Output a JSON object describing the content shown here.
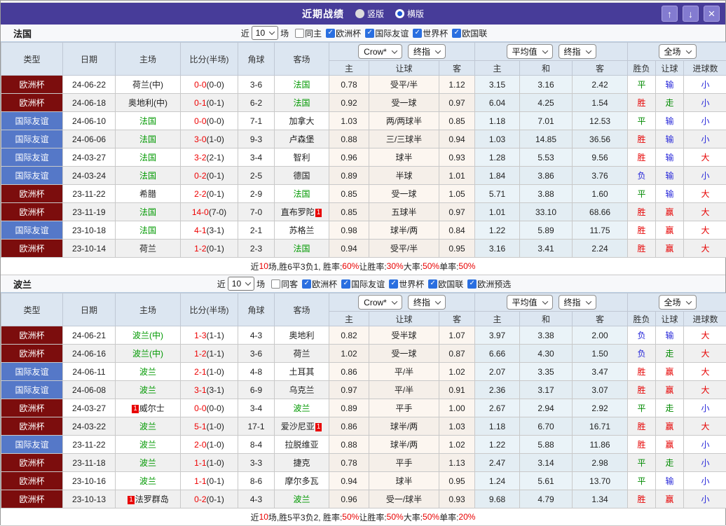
{
  "title_bar": {
    "title": "近期战绩",
    "radio_vertical": "竖版",
    "radio_horizontal": "横版",
    "up_icon": "↑",
    "down_icon": "↓",
    "close_icon": "×"
  },
  "colors": {
    "type": {
      "欧洲杯": "#7c0d0d",
      "国际友谊": "#5578c8"
    },
    "result": {
      "胜": "#e60000",
      "平": "#008a00",
      "负": "#2626d9",
      "赢": "#e60000",
      "走": "#008a00",
      "输": "#2626d9",
      "大": "#e60000",
      "小": "#2626d9"
    },
    "accent_purple": "#473c99",
    "header_bg": "#dce6f1",
    "checkbox_blue": "#2a6fe0"
  },
  "table_header": {
    "type": "类型",
    "date": "日期",
    "home": "主场",
    "score": "比分(半场)",
    "corner": "角球",
    "away": "客场",
    "odds_home": "主",
    "odds_line": "让球",
    "odds_away": "客",
    "avg_home": "主",
    "avg_draw": "和",
    "avg_away": "客",
    "res_wdl": "胜负",
    "res_handicap": "让球",
    "res_goals": "进球数",
    "dd_company": "Crow*",
    "dd_final1": "终指",
    "dd_average": "平均值",
    "dd_final2": "终指",
    "dd_fulltime": "全场"
  },
  "sections": [
    {
      "team": "法国",
      "filter": {
        "recent_label": "近",
        "count": "10",
        "matches_label": "场",
        "same_label": "同主",
        "same_checked": false,
        "leagues": [
          {
            "label": "欧洲杯",
            "checked": true
          },
          {
            "label": "国际友谊",
            "checked": true
          },
          {
            "label": "世界杯",
            "checked": true
          },
          {
            "label": "欧国联",
            "checked": true
          }
        ]
      },
      "rows": [
        {
          "type": "欧洲杯",
          "date": "24-06-22",
          "home": "荷兰(中)",
          "score_ft": "0-0",
          "score_ht": "(0-0)",
          "corner": "3-6",
          "away": "法国",
          "hl": "away",
          "odds_home": "0.78",
          "line": "受平/半",
          "odds_away": "1.12",
          "avg_home": "3.15",
          "avg_draw": "3.16",
          "avg_away": "2.42",
          "wdl": "平",
          "handicap": "输",
          "goals": "小"
        },
        {
          "type": "欧洲杯",
          "date": "24-06-18",
          "home": "奥地利(中)",
          "score_ft": "0-1",
          "score_ht": "(0-1)",
          "corner": "6-2",
          "away": "法国",
          "hl": "away",
          "odds_home": "0.92",
          "line": "受一球",
          "odds_away": "0.97",
          "avg_home": "6.04",
          "avg_draw": "4.25",
          "avg_away": "1.54",
          "wdl": "胜",
          "handicap": "走",
          "goals": "小"
        },
        {
          "type": "国际友谊",
          "date": "24-06-10",
          "home": "法国",
          "score_ft": "0-0",
          "score_ht": "(0-0)",
          "corner": "7-1",
          "away": "加拿大",
          "hl": "home",
          "odds_home": "1.03",
          "line": "两/两球半",
          "odds_away": "0.85",
          "avg_home": "1.18",
          "avg_draw": "7.01",
          "avg_away": "12.53",
          "wdl": "平",
          "handicap": "输",
          "goals": "小"
        },
        {
          "type": "国际友谊",
          "date": "24-06-06",
          "home": "法国",
          "score_ft": "3-0",
          "score_ht": "(1-0)",
          "corner": "9-3",
          "away": "卢森堡",
          "hl": "home",
          "odds_home": "0.88",
          "line": "三/三球半",
          "odds_away": "0.94",
          "avg_home": "1.03",
          "avg_draw": "14.85",
          "avg_away": "36.56",
          "wdl": "胜",
          "handicap": "输",
          "goals": "小"
        },
        {
          "type": "国际友谊",
          "date": "24-03-27",
          "home": "法国",
          "score_ft": "3-2",
          "score_ht": "(2-1)",
          "corner": "3-4",
          "away": "智利",
          "hl": "home",
          "odds_home": "0.96",
          "line": "球半",
          "odds_away": "0.93",
          "avg_home": "1.28",
          "avg_draw": "5.53",
          "avg_away": "9.56",
          "wdl": "胜",
          "handicap": "输",
          "goals": "大"
        },
        {
          "type": "国际友谊",
          "date": "24-03-24",
          "home": "法国",
          "score_ft": "0-2",
          "score_ht": "(0-1)",
          "corner": "2-5",
          "away": "德国",
          "hl": "home",
          "odds_home": "0.89",
          "line": "半球",
          "odds_away": "1.01",
          "avg_home": "1.84",
          "avg_draw": "3.86",
          "avg_away": "3.76",
          "wdl": "负",
          "handicap": "输",
          "goals": "小"
        },
        {
          "type": "欧洲杯",
          "date": "23-11-22",
          "home": "希腊",
          "score_ft": "2-2",
          "score_ht": "(0-1)",
          "corner": "2-9",
          "away": "法国",
          "hl": "away",
          "odds_home": "0.85",
          "line": "受一球",
          "odds_away": "1.05",
          "avg_home": "5.71",
          "avg_draw": "3.88",
          "avg_away": "1.60",
          "wdl": "平",
          "handicap": "输",
          "goals": "大"
        },
        {
          "type": "欧洲杯",
          "date": "23-11-19",
          "home": "法国",
          "score_ft": "14-0",
          "score_ht": "(7-0)",
          "corner": "7-0",
          "away": "直布罗陀",
          "away_rc": "1",
          "hl": "home",
          "odds_home": "0.85",
          "line": "五球半",
          "odds_away": "0.97",
          "avg_home": "1.01",
          "avg_draw": "33.10",
          "avg_away": "68.66",
          "wdl": "胜",
          "handicap": "赢",
          "goals": "大"
        },
        {
          "type": "国际友谊",
          "date": "23-10-18",
          "home": "法国",
          "score_ft": "4-1",
          "score_ht": "(3-1)",
          "corner": "2-1",
          "away": "苏格兰",
          "hl": "home",
          "odds_home": "0.98",
          "line": "球半/两",
          "odds_away": "0.84",
          "avg_home": "1.22",
          "avg_draw": "5.89",
          "avg_away": "11.75",
          "wdl": "胜",
          "handicap": "赢",
          "goals": "大"
        },
        {
          "type": "欧洲杯",
          "date": "23-10-14",
          "home": "荷兰",
          "score_ft": "1-2",
          "score_ht": "(0-1)",
          "corner": "2-3",
          "away": "法国",
          "hl": "away",
          "odds_home": "0.94",
          "line": "受平/半",
          "odds_away": "0.95",
          "avg_home": "3.16",
          "avg_draw": "3.41",
          "avg_away": "2.24",
          "wdl": "胜",
          "handicap": "赢",
          "goals": "大"
        }
      ],
      "summary_segments": [
        {
          "text": "近",
          "red": false
        },
        {
          "text": "10",
          "red": true
        },
        {
          "text": "场,胜6平3负1, 胜率:",
          "red": false
        },
        {
          "text": "60%",
          "red": true
        },
        {
          "text": " 让胜率:",
          "red": false
        },
        {
          "text": "30%",
          "red": true
        },
        {
          "text": " 大率:",
          "red": false
        },
        {
          "text": "50%",
          "red": true
        },
        {
          "text": " 单率:",
          "red": false
        },
        {
          "text": "50%",
          "red": true
        }
      ]
    },
    {
      "team": "波兰",
      "filter": {
        "recent_label": "近",
        "count": "10",
        "matches_label": "场",
        "same_label": "同客",
        "same_checked": false,
        "leagues": [
          {
            "label": "欧洲杯",
            "checked": true
          },
          {
            "label": "国际友谊",
            "checked": true
          },
          {
            "label": "世界杯",
            "checked": true
          },
          {
            "label": "欧国联",
            "checked": true
          },
          {
            "label": "欧洲预选",
            "checked": true
          }
        ]
      },
      "rows": [
        {
          "type": "欧洲杯",
          "date": "24-06-21",
          "home": "波兰(中)",
          "score_ft": "1-3",
          "score_ht": "(1-1)",
          "corner": "4-3",
          "away": "奥地利",
          "hl": "home",
          "odds_home": "0.82",
          "line": "受半球",
          "odds_away": "1.07",
          "avg_home": "3.97",
          "avg_draw": "3.38",
          "avg_away": "2.00",
          "wdl": "负",
          "handicap": "输",
          "goals": "大"
        },
        {
          "type": "欧洲杯",
          "date": "24-06-16",
          "home": "波兰(中)",
          "score_ft": "1-2",
          "score_ht": "(1-1)",
          "corner": "3-6",
          "away": "荷兰",
          "hl": "home",
          "odds_home": "1.02",
          "line": "受一球",
          "odds_away": "0.87",
          "avg_home": "6.66",
          "avg_draw": "4.30",
          "avg_away": "1.50",
          "wdl": "负",
          "handicap": "走",
          "goals": "大"
        },
        {
          "type": "国际友谊",
          "date": "24-06-11",
          "home": "波兰",
          "score_ft": "2-1",
          "score_ht": "(1-0)",
          "corner": "4-8",
          "away": "土耳其",
          "hl": "home",
          "odds_home": "0.86",
          "line": "平/半",
          "odds_away": "1.02",
          "avg_home": "2.07",
          "avg_draw": "3.35",
          "avg_away": "3.47",
          "wdl": "胜",
          "handicap": "赢",
          "goals": "大"
        },
        {
          "type": "国际友谊",
          "date": "24-06-08",
          "home": "波兰",
          "score_ft": "3-1",
          "score_ht": "(3-1)",
          "corner": "6-9",
          "away": "乌克兰",
          "hl": "home",
          "odds_home": "0.97",
          "line": "平/半",
          "odds_away": "0.91",
          "avg_home": "2.36",
          "avg_draw": "3.17",
          "avg_away": "3.07",
          "wdl": "胜",
          "handicap": "赢",
          "goals": "大"
        },
        {
          "type": "欧洲杯",
          "date": "24-03-27",
          "home": "威尔士",
          "home_rc": "1",
          "score_ft": "0-0",
          "score_ht": "(0-0)",
          "corner": "3-4",
          "away": "波兰",
          "hl": "away",
          "odds_home": "0.89",
          "line": "平手",
          "odds_away": "1.00",
          "avg_home": "2.67",
          "avg_draw": "2.94",
          "avg_away": "2.92",
          "wdl": "平",
          "handicap": "走",
          "goals": "小"
        },
        {
          "type": "欧洲杯",
          "date": "24-03-22",
          "home": "波兰",
          "score_ft": "5-1",
          "score_ht": "(1-0)",
          "corner": "17-1",
          "away": "爱沙尼亚",
          "away_rc": "1",
          "hl": "home",
          "odds_home": "0.86",
          "line": "球半/两",
          "odds_away": "1.03",
          "avg_home": "1.18",
          "avg_draw": "6.70",
          "avg_away": "16.71",
          "wdl": "胜",
          "handicap": "赢",
          "goals": "大"
        },
        {
          "type": "国际友谊",
          "date": "23-11-22",
          "home": "波兰",
          "score_ft": "2-0",
          "score_ht": "(1-0)",
          "corner": "8-4",
          "away": "拉脱维亚",
          "hl": "home",
          "odds_home": "0.88",
          "line": "球半/两",
          "odds_away": "1.02",
          "avg_home": "1.22",
          "avg_draw": "5.88",
          "avg_away": "11.86",
          "wdl": "胜",
          "handicap": "赢",
          "goals": "小"
        },
        {
          "type": "欧洲杯",
          "date": "23-11-18",
          "home": "波兰",
          "score_ft": "1-1",
          "score_ht": "(1-0)",
          "corner": "3-3",
          "away": "捷克",
          "hl": "home",
          "odds_home": "0.78",
          "line": "平手",
          "odds_away": "1.13",
          "avg_home": "2.47",
          "avg_draw": "3.14",
          "avg_away": "2.98",
          "wdl": "平",
          "handicap": "走",
          "goals": "小"
        },
        {
          "type": "欧洲杯",
          "date": "23-10-16",
          "home": "波兰",
          "score_ft": "1-1",
          "score_ht": "(0-1)",
          "corner": "8-6",
          "away": "摩尔多瓦",
          "hl": "home",
          "odds_home": "0.94",
          "line": "球半",
          "odds_away": "0.95",
          "avg_home": "1.24",
          "avg_draw": "5.61",
          "avg_away": "13.70",
          "wdl": "平",
          "handicap": "输",
          "goals": "小"
        },
        {
          "type": "欧洲杯",
          "date": "23-10-13",
          "home": "法罗群岛",
          "home_rc": "1",
          "score_ft": "0-2",
          "score_ht": "(0-1)",
          "corner": "4-3",
          "away": "波兰",
          "hl": "away",
          "odds_home": "0.96",
          "line": "受一/球半",
          "odds_away": "0.93",
          "avg_home": "9.68",
          "avg_draw": "4.79",
          "avg_away": "1.34",
          "wdl": "胜",
          "handicap": "赢",
          "goals": "小"
        }
      ],
      "summary_segments": [
        {
          "text": "近",
          "red": false
        },
        {
          "text": "10",
          "red": true
        },
        {
          "text": "场,胜5平3负2, 胜率:",
          "red": false
        },
        {
          "text": "50%",
          "red": true
        },
        {
          "text": " 让胜率:",
          "red": false
        },
        {
          "text": "50%",
          "red": true
        },
        {
          "text": " 大率:",
          "red": false
        },
        {
          "text": "50%",
          "red": true
        },
        {
          "text": " 单率:",
          "red": false
        },
        {
          "text": "20%",
          "red": true
        }
      ]
    }
  ]
}
